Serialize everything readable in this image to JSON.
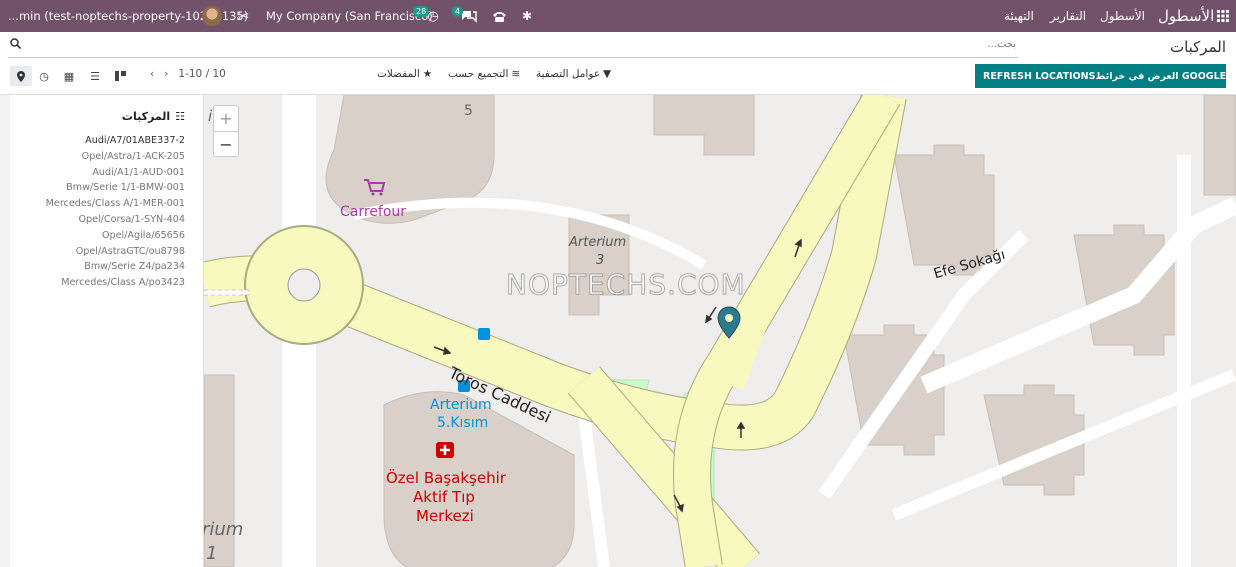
{
  "navbar": {
    "database": "...min (test-noptechs-property-10281135)",
    "company": "My Company (San Francisco)",
    "activity_count": "28",
    "message_count": "4",
    "menu": [
      "التهيئة",
      "التقارير",
      "الأسطول"
    ],
    "brand": "الأسطول",
    "colors": {
      "bar": "#71526a",
      "badge": "#1a9b8c"
    },
    "icons": [
      "tools-icon",
      "clock-icon",
      "chat-icon",
      "phone-icon",
      "bug-icon",
      "apps-grid-icon"
    ]
  },
  "control_panel": {
    "title": "المركبات",
    "search_placeholder": "بحث...",
    "buttons": {
      "google_maps": "العرض في خرائط GOOGLE",
      "refresh": "REFRESH LOCATIONS"
    },
    "filters": {
      "filters": "عوامل التصفية",
      "group_by": "التجميع حسب",
      "favorites": "المفضلات"
    },
    "pager": "1-10 / 10",
    "views": [
      "kanban",
      "list",
      "pivot",
      "activity",
      "map"
    ],
    "active_view": "map",
    "accent": "#017e84"
  },
  "sidebar": {
    "title": "المركبات",
    "items": [
      "Audi/A7/01ABE337-2",
      "Opel/Astra/1-ACK-205",
      "Audi/A1/1-AUD-001",
      "Bmw/Serie 1/1-BMW-001",
      "Mercedes/Class A/1-MER-001",
      "Opel/Corsa/1-SYN-404",
      "Opel/Agila/65656",
      "Opel/AstraGTC/ou8798",
      "Bmw/Serie Z4/pa234",
      "Mercedes/Class A/po3423"
    ]
  },
  "map": {
    "zoom_in": "+",
    "zoom_out": "−",
    "watermark": "NOPTECHS.COM",
    "labels": {
      "carrefour": "Carrefour",
      "arterium_3": "Arterium",
      "arterium_3_num": "3",
      "toros": "Toros Caddesi",
      "efe": "Efe Sokağı",
      "arterium_5": "Arterium",
      "arterium_5_sub": "5.Kısım",
      "hospital_1": "Özel Başakşehir",
      "hospital_2": "Aktif Tıp",
      "hospital_3": "Merkezi",
      "top_num": "5",
      "left_frag_1": "ium",
      "left_frag_2": "rium",
      "left_frag_3": "1"
    },
    "colors": {
      "road": "#f7f9bf",
      "green": "#c8facc",
      "building": "#d9d0c9",
      "pin": "#2c7a8c",
      "label_purple": "#ac39ac",
      "label_blue": "#0092da",
      "label_red": "#c00"
    }
  }
}
